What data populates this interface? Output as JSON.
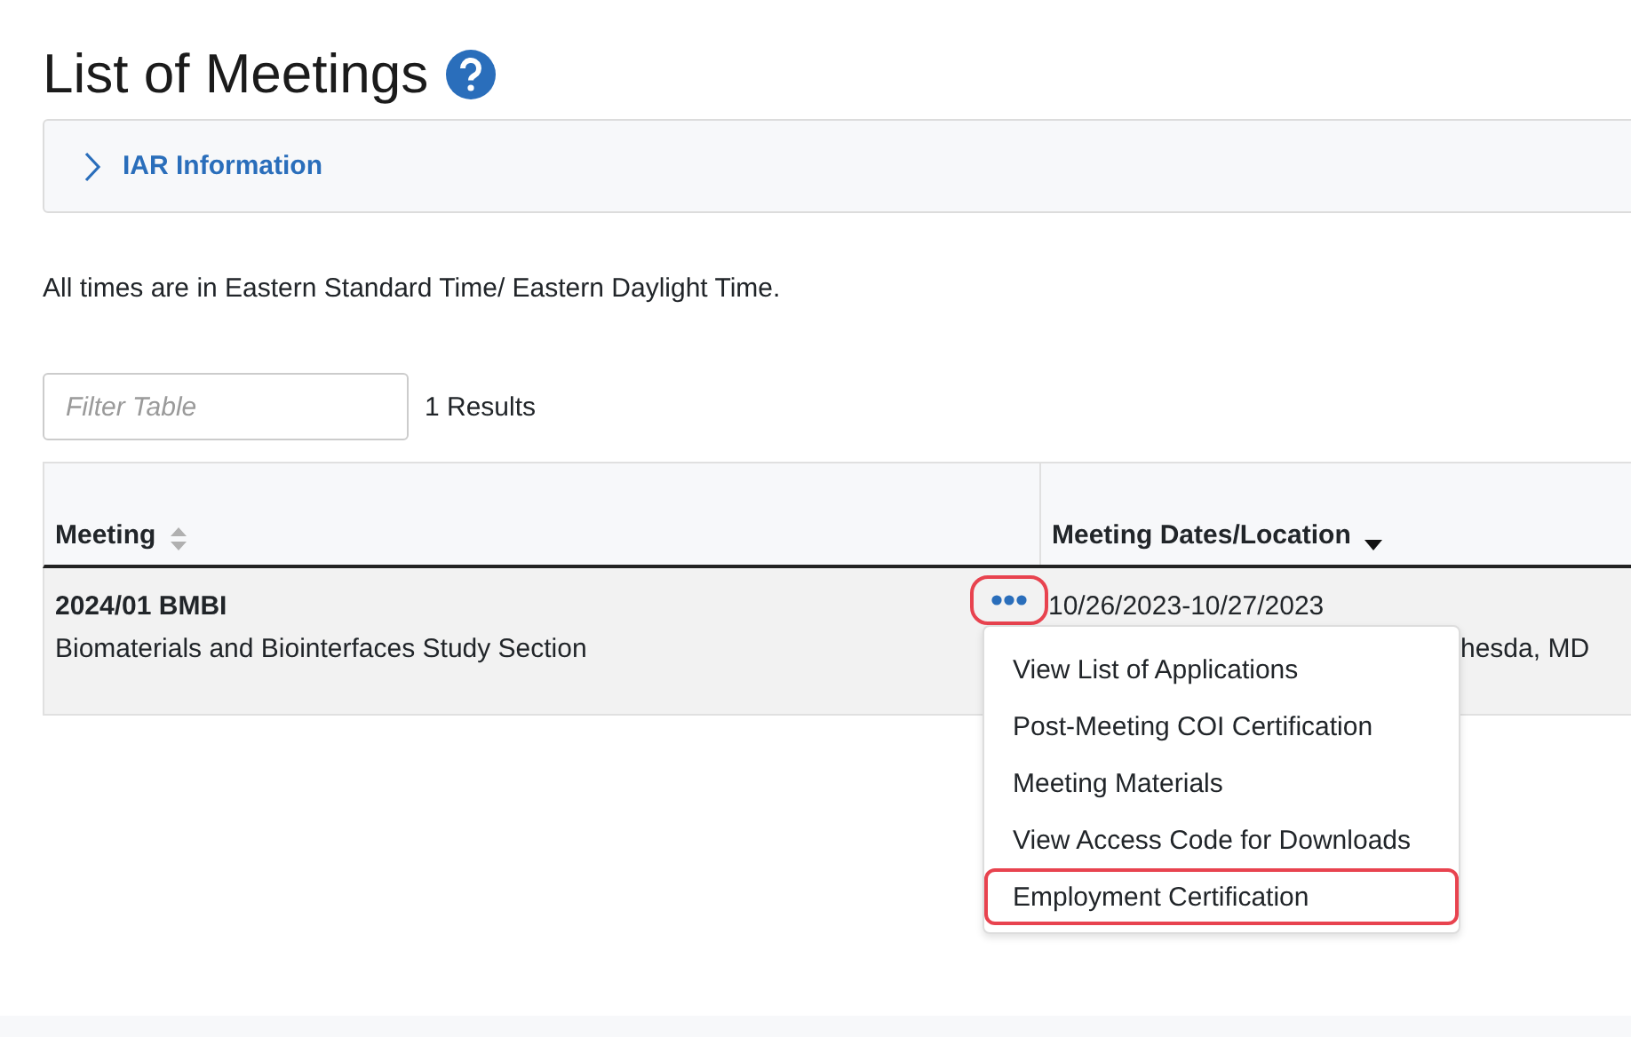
{
  "page": {
    "title": "List of Meetings"
  },
  "iar_panel": {
    "label": "IAR Information",
    "expanded": false
  },
  "note": "All times are in Eastern Standard Time/ Eastern Daylight Time.",
  "filter": {
    "placeholder": "Filter Table"
  },
  "results": "1 Results",
  "table": {
    "columns": [
      {
        "label": "Meeting",
        "sorted": false
      },
      {
        "label": "Meeting Dates/Location",
        "sorted": true
      }
    ],
    "rows": [
      {
        "code": "2024/01 BMBI",
        "name": "Biomaterials and Biointerfaces Study Section",
        "dates": "10/26/2023-10/27/2023",
        "location": "hesda, MD",
        "actions_highlighted": true
      }
    ]
  },
  "menu": {
    "items": [
      {
        "label": "View List of Applications",
        "highlighted": false
      },
      {
        "label": "Post-Meeting COI Certification",
        "highlighted": false
      },
      {
        "label": "Meeting Materials",
        "highlighted": false
      },
      {
        "label": "View Access Code for Downloads",
        "highlighted": false
      },
      {
        "label": "Employment Certification",
        "highlighted": true
      }
    ]
  }
}
